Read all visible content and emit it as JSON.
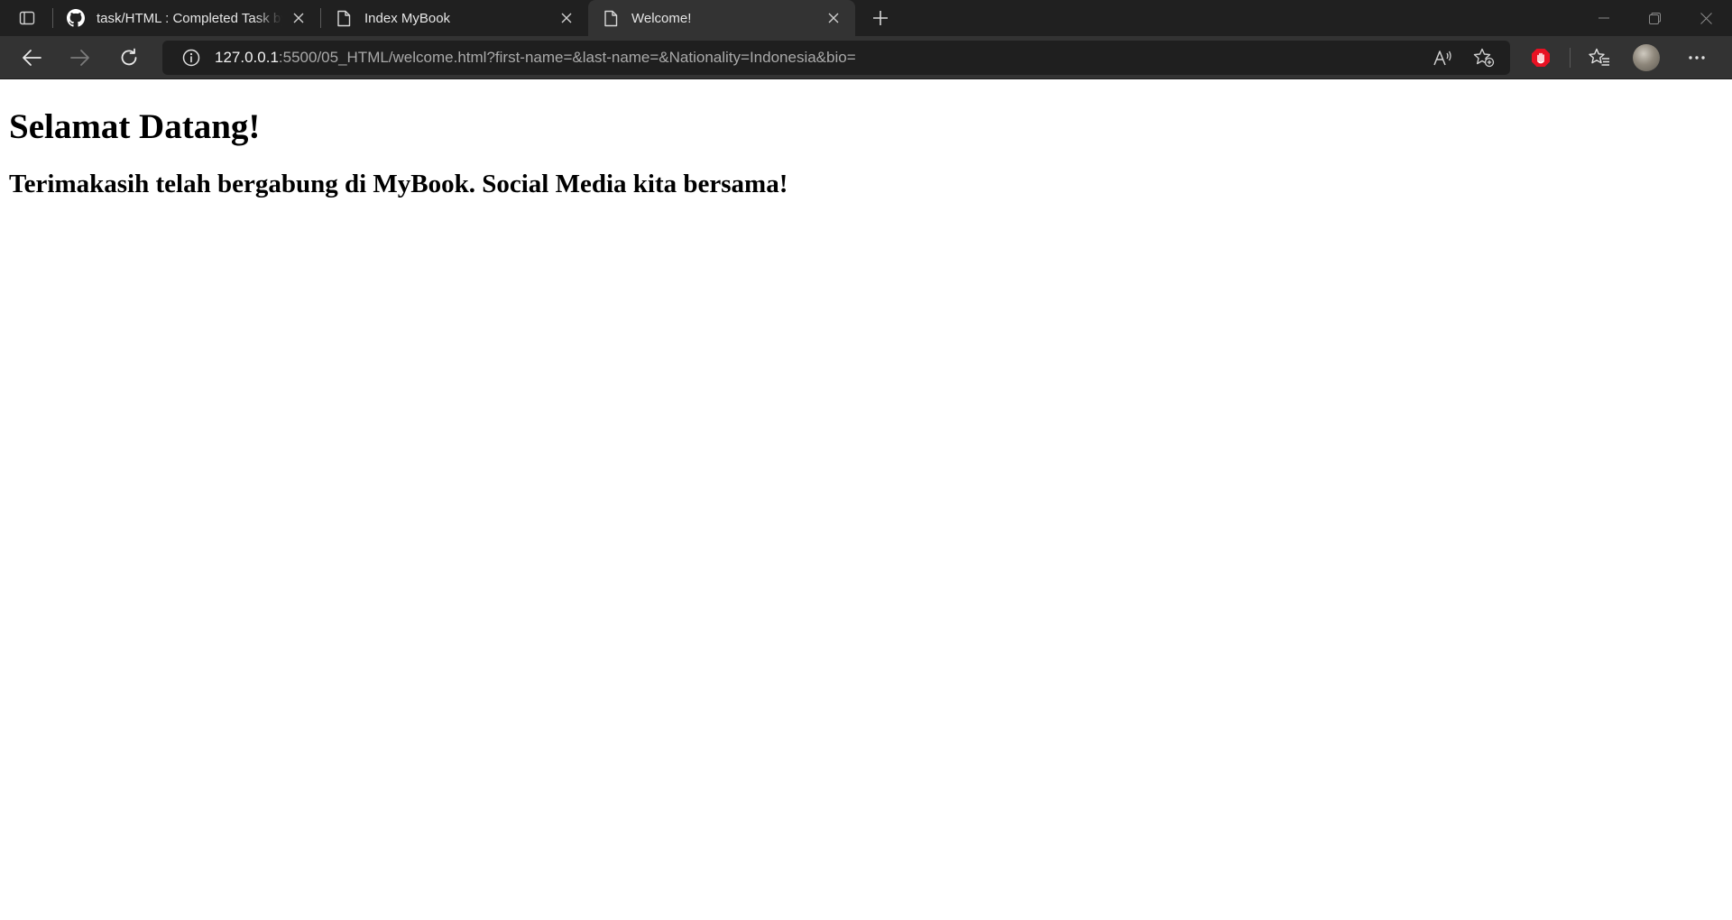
{
  "browser": {
    "tabs": [
      {
        "title": "task/HTML : Completed Task by ",
        "favicon": "github-icon",
        "active": false
      },
      {
        "title": "Index MyBook",
        "favicon": "document-icon",
        "active": false
      },
      {
        "title": "Welcome!",
        "favicon": "document-icon",
        "active": true
      }
    ],
    "address": {
      "host": "127.0.0.1",
      "path": ":5500/05_HTML/welcome.html?first-name=&last-name=&Nationality=Indonesia&bio="
    },
    "icons": {
      "tab_actions": "tab-actions-icon",
      "back": "back-arrow-icon",
      "forward": "forward-arrow-icon",
      "refresh": "refresh-icon",
      "site_info": "info-icon",
      "read_aloud": "read-aloud-icon",
      "add_favorite": "add-favorite-icon",
      "extension": "adblock-extension-icon",
      "favorites": "favorites-icon",
      "profile": "profile-avatar",
      "menu": "more-menu-icon",
      "new_tab": "plus-icon",
      "minimize": "minimize-icon",
      "restore": "restore-icon",
      "close_window": "close-window-icon"
    },
    "colors": {
      "tabstrip": "#202020",
      "toolbar": "#333333",
      "address_bar": "#1f1f1f",
      "extension_red": "#e81123"
    }
  },
  "page": {
    "heading": "Selamat Datang!",
    "subheading": "Terimakasih telah bergabung di MyBook. Social Media kita bersama!"
  }
}
